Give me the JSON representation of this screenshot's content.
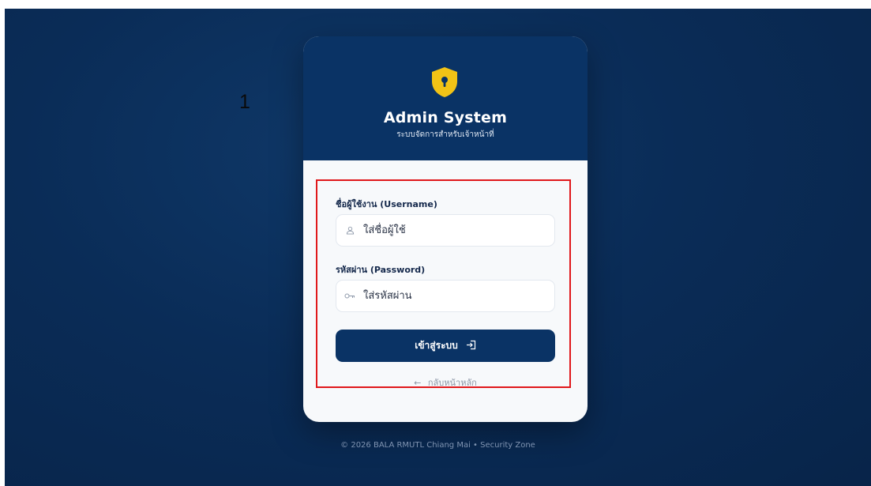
{
  "annotation": {
    "number": "1"
  },
  "card": {
    "title": "Admin System",
    "subtitle": "ระบบจัดการสำหรับเจ้าหน้าที่",
    "shield_color": "#f2c316",
    "header_color": "#0a3365"
  },
  "form": {
    "username_label": "ชื่อผู้ใช้งาน (Username)",
    "username_placeholder": "ใส่ชื่อผู้ใช้",
    "username_value": "",
    "password_label": "รหัสผ่าน (Password)",
    "password_placeholder": "ใส่รหัสผ่าน",
    "password_value": "",
    "login_label": "เข้าสู่ระบบ",
    "back_arrow": "←",
    "back_label": "กลับหน้าหลัก"
  },
  "icons": {
    "user": "user-icon",
    "key": "key-icon",
    "login": "login-icon",
    "shield": "shield-icon"
  },
  "footer": {
    "text": "© 2026 BALA RMUTL Chiang Mai • Security Zone"
  },
  "highlight_color": "#e0181b"
}
